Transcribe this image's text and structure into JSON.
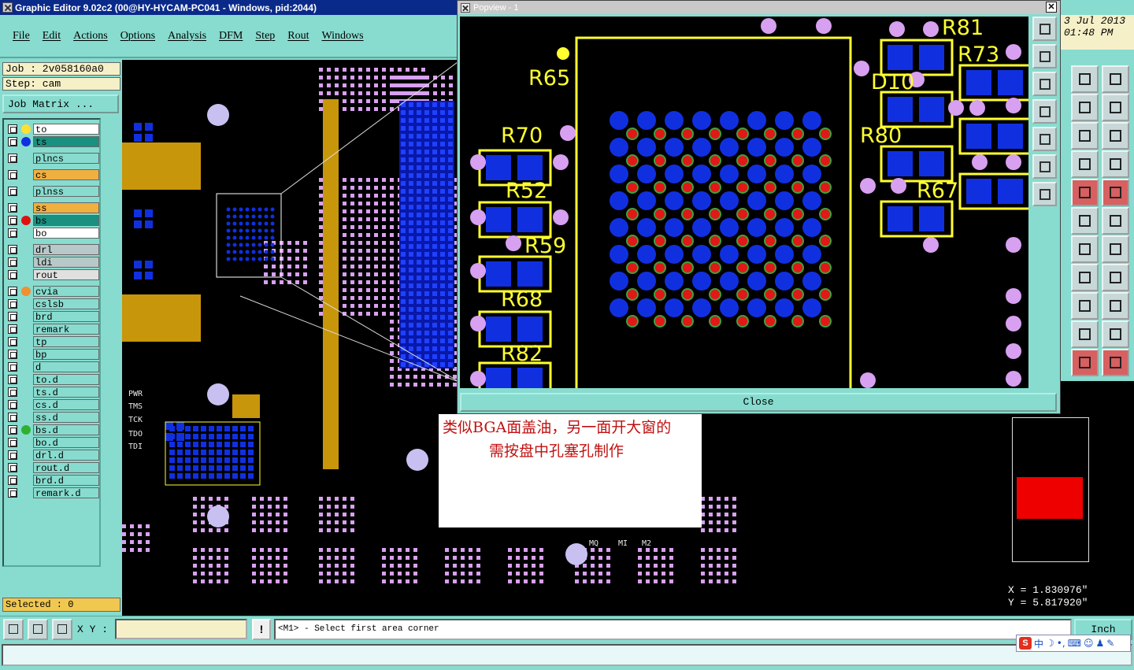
{
  "window": {
    "title": "Graphic Editor 9.02c2 (00@HY-HYCAM-PC041 - Windows, pid:2044)"
  },
  "menu": [
    "File",
    "Edit",
    "Actions",
    "Options",
    "Analysis",
    "DFM",
    "Step",
    "Rout",
    "Windows"
  ],
  "job": {
    "job_label": "Job : 2v058160a0",
    "step_label": "Step: cam",
    "matrix_button": "Job Matrix ..."
  },
  "layers": [
    {
      "name": "to",
      "color": "#ffffff",
      "dot": "#ffe030"
    },
    {
      "name": "ts",
      "color": "#1a9080",
      "dot": "#1030e0"
    },
    {
      "name": "plncs",
      "color": "#87dccf",
      "dot": ""
    },
    {
      "name": "cs",
      "color": "#f0b040",
      "dot": ""
    },
    {
      "name": "plnss",
      "color": "#87dccf",
      "dot": ""
    },
    {
      "name": "ss",
      "color": "#f0b040",
      "dot": ""
    },
    {
      "name": "bs",
      "color": "#1a9080",
      "dot": "#e01010"
    },
    {
      "name": "bo",
      "color": "#ffffff",
      "dot": ""
    },
    {
      "name": "drl",
      "color": "#b8c8c8",
      "dot": ""
    },
    {
      "name": "ldi",
      "color": "#b8c8c8",
      "dot": ""
    },
    {
      "name": "rout",
      "color": "#e0e0e0",
      "dot": ""
    },
    {
      "name": "cvia",
      "color": "#87dccf",
      "dot": "#f09030"
    },
    {
      "name": "cslsb",
      "color": "#87dccf",
      "dot": ""
    },
    {
      "name": "brd",
      "color": "#87dccf",
      "dot": ""
    },
    {
      "name": "remark",
      "color": "#87dccf",
      "dot": ""
    },
    {
      "name": "tp",
      "color": "#87dccf",
      "dot": ""
    },
    {
      "name": "bp",
      "color": "#87dccf",
      "dot": ""
    },
    {
      "name": "d",
      "color": "#87dccf",
      "dot": ""
    },
    {
      "name": "to.d",
      "color": "#87dccf",
      "dot": ""
    },
    {
      "name": "ts.d",
      "color": "#87dccf",
      "dot": ""
    },
    {
      "name": "cs.d",
      "color": "#87dccf",
      "dot": ""
    },
    {
      "name": "ss.d",
      "color": "#87dccf",
      "dot": ""
    },
    {
      "name": "bs.d",
      "color": "#87dccf",
      "dot": "#30b030"
    },
    {
      "name": "bo.d",
      "color": "#87dccf",
      "dot": ""
    },
    {
      "name": "drl.d",
      "color": "#87dccf",
      "dot": ""
    },
    {
      "name": "rout.d",
      "color": "#87dccf",
      "dot": ""
    },
    {
      "name": "brd.d",
      "color": "#87dccf",
      "dot": ""
    },
    {
      "name": "remark.d",
      "color": "#87dccf",
      "dot": ""
    }
  ],
  "selected_label": "Selected : 0",
  "popview": {
    "title": "Popview - 1",
    "close_label": "Close",
    "refdes": [
      "R81",
      "R73",
      "D10",
      "R65",
      "R70",
      "R80",
      "R52",
      "R67",
      "R59",
      "R68",
      "R82"
    ]
  },
  "canvas_labels": [
    "PWR",
    "TMS",
    "TCK",
    "TDO",
    "TDI",
    "MQ",
    "MI",
    "M2"
  ],
  "date": {
    "line1": "3 Jul 2013",
    "line2": "01:48 PM"
  },
  "note": {
    "line1": "类似BGA面盖油，另一面开大窗的",
    "line2": "需按盘中孔塞孔制作"
  },
  "coords": {
    "x": "X = 1.830976\"",
    "y": "Y = 5.817920\""
  },
  "statusbar": {
    "xy_label": "X Y :",
    "xy_value": "",
    "bang": "!",
    "prompt": "<M1> - Select first area corner",
    "unit": "Inch"
  },
  "ime": {
    "badge": "S",
    "lang": "中"
  },
  "colors": {
    "accent": "#87dccf",
    "pcb_bg": "#000000",
    "pad_blue": "#1030e0",
    "silk": "#ffff30",
    "via": "#d8a0f0"
  }
}
